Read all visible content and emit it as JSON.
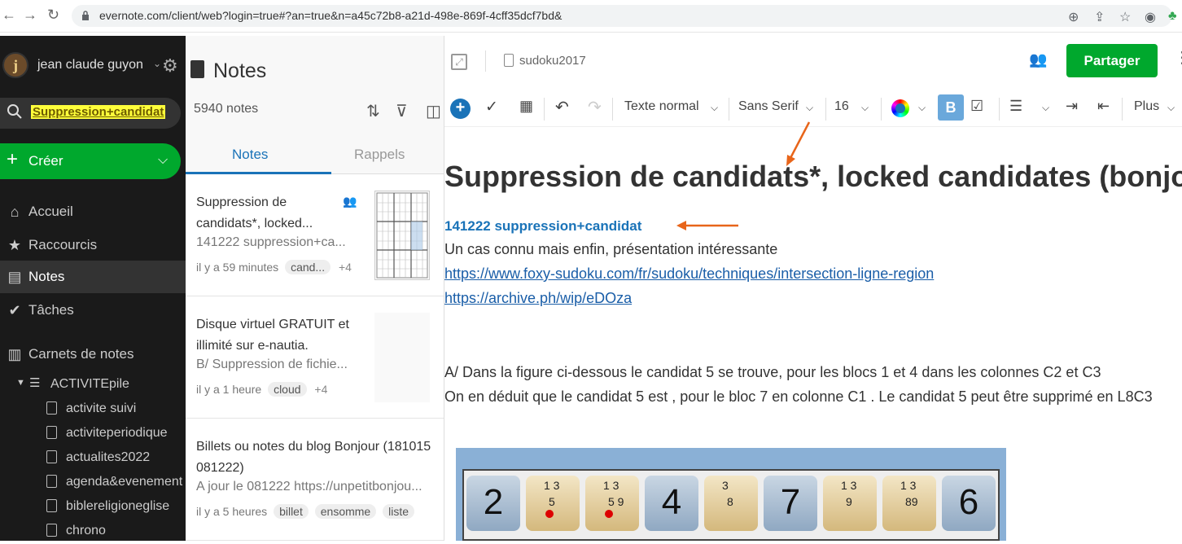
{
  "browser": {
    "url": "evernote.com/client/web?login=true#?an=true&n=a45c72b8-a21d-498e-869f-4cff35dcf7bd&"
  },
  "sidebar": {
    "username": "jean claude guyon",
    "search_value": "Suppression+candidat",
    "create_label": "Créer",
    "nav": [
      {
        "label": "Accueil",
        "icon": "home-icon"
      },
      {
        "label": "Raccourcis",
        "icon": "star-icon"
      },
      {
        "label": "Notes",
        "icon": "note-icon",
        "active": true
      },
      {
        "label": "Tâches",
        "icon": "check-circle-icon"
      }
    ],
    "notebooks_label": "Carnets de notes",
    "stack_label": "ACTIVITEpile",
    "notebooks": [
      "activite suivi",
      "activiteperiodique",
      "actualites2022",
      "agenda&evenement",
      "biblereligioneglise",
      "chrono"
    ]
  },
  "noteslist": {
    "title": "Notes",
    "count": "5940 notes",
    "tabs": [
      "Notes",
      "Rappels"
    ],
    "cards": [
      {
        "title": "Suppression de candidats*, locked...",
        "snippet": "141222 suppression+ca...",
        "time": "il y a 59 minutes",
        "tags": [
          "cand..."
        ],
        "more": "+4"
      },
      {
        "title": "Disque virtuel GRATUIT et illimité sur e-nautia.",
        "snippet": "B/ Suppression de fichie...",
        "time": "il y a 1 heure",
        "tags": [
          "cloud"
        ],
        "more": "+4"
      },
      {
        "title": "Billets ou notes du blog Bonjour (181015 081222)",
        "snippet": "A jour le 081222 https://unpetitbonjou...",
        "time": "il y a 5 heures",
        "tags": [
          "billet",
          "ensomme",
          "liste"
        ],
        "more": ""
      }
    ]
  },
  "editor": {
    "notebook": "sudoku2017",
    "share_label": "Partager",
    "toolbar": {
      "style": "Texte normal",
      "font": "Sans Serif",
      "size": "16",
      "bold": "B",
      "more": "Plus"
    },
    "title": "Suppression de candidats*, locked candidates  (bonjour)",
    "subtitle_link": "141222 suppression+candidat",
    "line1": "Un cas connu mais enfin, présentation intéressante",
    "link1": "https://www.foxy-sudoku.com/fr/sudoku/techniques/intersection-ligne-region",
    "link2": "https://archive.ph/wip/eDOza",
    "paraA": "A/  Dans la figure ci-dessous le candidat 5 se trouve, pour les blocs 1 et 4 dans les colonnes C2 et C3",
    "paraB": " On en déduit que le candidat 5 est , pour le bloc 7 en colonne C1 . Le candidat 5 peut être supprimé en L8C3",
    "sudoku_row": [
      "2",
      "",
      "",
      "4",
      "",
      "7",
      "",
      "",
      "6"
    ],
    "sudoku_small": [
      {
        "i": 1,
        "top": "1  3",
        "bottom": "5"
      },
      {
        "i": 2,
        "top": "1  3",
        "bottom": "5 9"
      },
      {
        "i": 4,
        "top": "3",
        "bottom": "8"
      },
      {
        "i": 6,
        "top": "1  3",
        "bottom": "9"
      },
      {
        "i": 7,
        "top": "1  3",
        "bottom": "89"
      }
    ]
  },
  "colors": {
    "accent_green": "#00a82d",
    "link_blue": "#1a73b8",
    "sidebar_bg": "#1a1a1a",
    "arrow_orange": "#e8651a"
  }
}
